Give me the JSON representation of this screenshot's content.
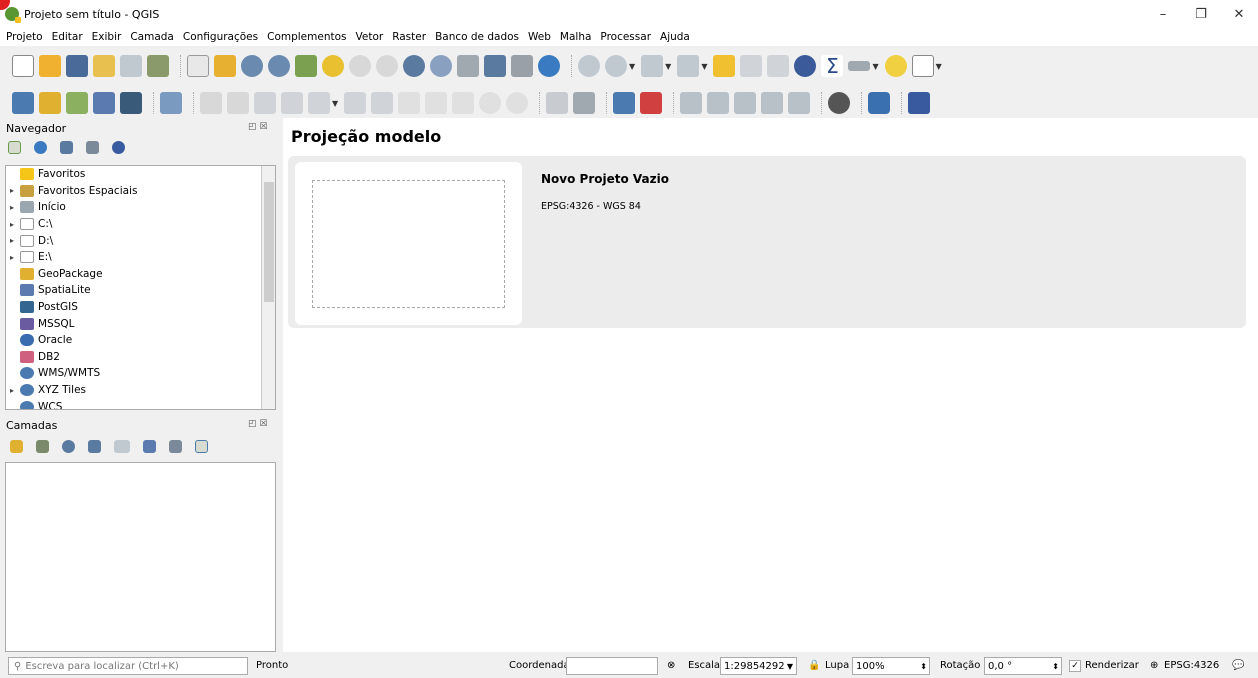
{
  "window": {
    "title": "Projeto sem título - QGIS",
    "controls": [
      "–",
      "❐",
      "✕"
    ]
  },
  "menu": [
    "Projeto",
    "Editar",
    "Exibir",
    "Camada",
    "Configurações",
    "Complementos",
    "Vetor",
    "Raster",
    "Banco de dados",
    "Web",
    "Malha",
    "Processar",
    "Ajuda"
  ],
  "navigator": {
    "title": "Navegador",
    "items": [
      {
        "label": "Favoritos",
        "expand": "",
        "icon": "star-icon",
        "color": "#f5c518"
      },
      {
        "label": "Favoritos Espaciais",
        "expand": "▸",
        "icon": "bookmark-icon",
        "color": "#c8a040"
      },
      {
        "label": "Início",
        "expand": "▸",
        "icon": "home-icon",
        "color": "#9aa7b0"
      },
      {
        "label": "C:\\",
        "expand": "▸",
        "icon": "folder-icon",
        "color": "#d8d8d8"
      },
      {
        "label": "D:\\",
        "expand": "▸",
        "icon": "folder-icon",
        "color": "#d8d8d8"
      },
      {
        "label": "E:\\",
        "expand": "▸",
        "icon": "folder-icon",
        "color": "#d8d8d8"
      },
      {
        "label": "GeoPackage",
        "expand": "",
        "icon": "geopackage-icon",
        "color": "#e0b030"
      },
      {
        "label": "SpatiaLite",
        "expand": "",
        "icon": "feather-icon",
        "color": "#5a7ab0"
      },
      {
        "label": "PostGIS",
        "expand": "",
        "icon": "elephant-icon",
        "color": "#336791"
      },
      {
        "label": "MSSQL",
        "expand": "",
        "icon": "mssql-icon",
        "color": "#6a5aa0"
      },
      {
        "label": "Oracle",
        "expand": "",
        "icon": "oracle-icon",
        "color": "#3a6ab0"
      },
      {
        "label": "DB2",
        "expand": "",
        "icon": "db2-icon",
        "color": "#d06080"
      },
      {
        "label": "WMS/WMTS",
        "expand": "",
        "icon": "globe-icon",
        "color": "#4a7ab0"
      },
      {
        "label": "XYZ Tiles",
        "expand": "▸",
        "icon": "globe-icon",
        "color": "#4a7ab0"
      },
      {
        "label": "WCS",
        "expand": "",
        "icon": "globe-icon",
        "color": "#4a7ab0"
      }
    ]
  },
  "layers": {
    "title": "Camadas"
  },
  "main": {
    "heading": "Projeção modelo",
    "template": {
      "name": "Novo Projeto Vazio",
      "crs": "EPSG:4326 - WGS 84"
    }
  },
  "status": {
    "search_placeholder": "Escreva para localizar (Ctrl+K)",
    "ready": "Pronto",
    "coord_label": "Coordenada",
    "coord_value": "",
    "scale_label": "Escala",
    "scale_value": "1:29854292",
    "magnifier_label": "Lupa",
    "magnifier_value": "100%",
    "rotation_label": "Rotação",
    "rotation_value": "0,0 °",
    "render_label": "Renderizar",
    "crs": "EPSG:4326"
  }
}
